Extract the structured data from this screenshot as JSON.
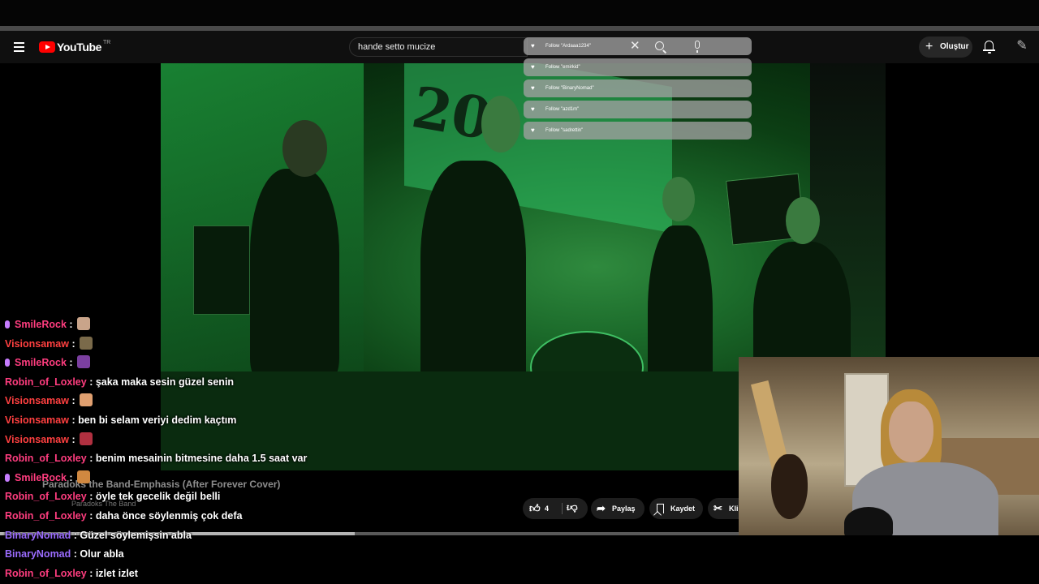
{
  "header": {
    "logo_text": "YouTube",
    "logo_region": "TR",
    "search_value": "hande setto mucize",
    "create_label": "Oluştur"
  },
  "follow_suggestions": [
    {
      "label": "Follow \"Ardaaa1234\""
    },
    {
      "label": "Follow \"emirkid\""
    },
    {
      "label": "Follow \"BinaryNomad\""
    },
    {
      "label": "Follow \"azd1m\""
    },
    {
      "label": "Follow \"sadrettin\""
    }
  ],
  "video": {
    "title": "Paradoks the Band-Emphasis (After Forever Cover)",
    "channel": "Paradoks The Band",
    "progress": 0.48,
    "likes": "4",
    "share_label": "Paylaş",
    "save_label": "Kaydet",
    "clip_label": "Kli",
    "sign_text": "20"
  },
  "chat": [
    {
      "user": "SmileRock",
      "message": "",
      "mic": true,
      "emote_color": "#c9a48a"
    },
    {
      "user": "Visionsamaw",
      "message": "",
      "mic": false,
      "emote_color": "#7a6a4a"
    },
    {
      "user": "SmileRock",
      "message": "",
      "mic": true,
      "emote_color": "#7b3fa0"
    },
    {
      "user": "Robin_of_Loxley",
      "message": "şaka maka sesin güzel senin",
      "mic": false
    },
    {
      "user": "Visionsamaw",
      "message": "",
      "mic": false,
      "emote_color": "#e0a070"
    },
    {
      "user": "Visionsamaw",
      "message": "ben bi selam veriyi dedim kaçtım",
      "mic": false
    },
    {
      "user": "Visionsamaw",
      "message": "",
      "mic": false,
      "emote_color": "#b03040"
    },
    {
      "user": "Robin_of_Loxley",
      "message": "benim mesainin bitmesine daha 1.5 saat var",
      "mic": false
    },
    {
      "user": "SmileRock",
      "message": "",
      "mic": true,
      "emote_color": "#d08840"
    },
    {
      "user": "Robin_of_Loxley",
      "message": "öyle tek gecelik değil belli",
      "mic": false
    },
    {
      "user": "Robin_of_Loxley",
      "message": "daha önce söylenmiş çok defa",
      "mic": false
    },
    {
      "user": "BinaryNomad",
      "message": "Güzel söylemişsin abla",
      "mic": false
    },
    {
      "user": "BinaryNomad",
      "message": "Olur abla",
      "mic": false
    },
    {
      "user": "Robin_of_Loxley",
      "message": "izlet izlet",
      "mic": false
    }
  ]
}
